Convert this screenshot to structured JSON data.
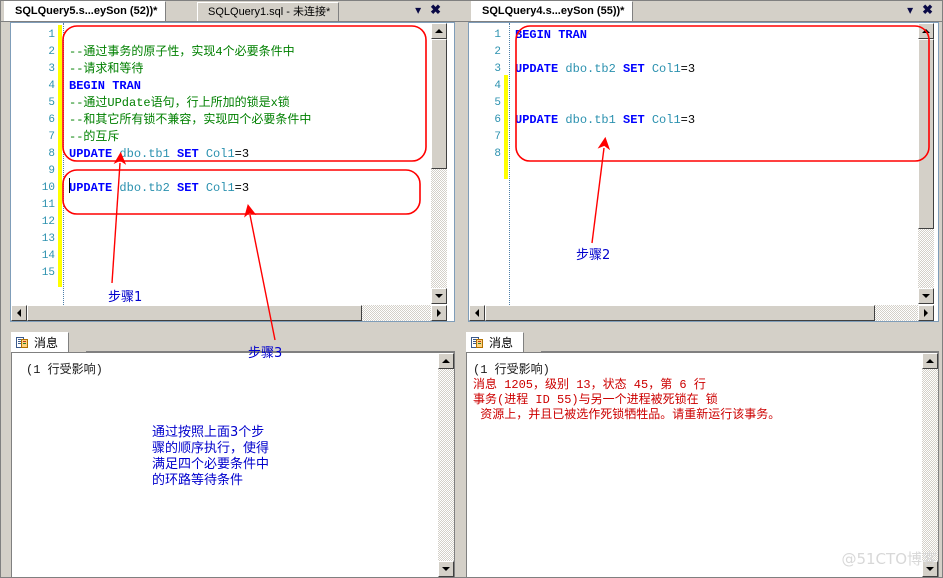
{
  "watermark": "@51CTO博客",
  "left_pane": {
    "tabs": [
      {
        "label": "SQLQuery5.s...eySon  (52))*",
        "active": true
      },
      {
        "label": "SQLQuery1.sql - 未连接*",
        "active": false
      }
    ],
    "window_buttons": {
      "dropdown": "▾",
      "close": "✖"
    },
    "editor": {
      "line_numbers": [
        "1",
        "2",
        "3",
        "4",
        "5",
        "6",
        "7",
        "8",
        "9",
        "10",
        "11",
        "12",
        "13",
        "14",
        "15"
      ],
      "lines": [
        {
          "n": 1,
          "segments": []
        },
        {
          "n": 2,
          "segments": [
            {
              "t": "--通过事务的原子性，实现4个必要条件中",
              "c": "cmt"
            }
          ]
        },
        {
          "n": 3,
          "segments": [
            {
              "t": "--请求和等待",
              "c": "cmt"
            }
          ]
        },
        {
          "n": 4,
          "segments": [
            {
              "t": "BEGIN TRAN",
              "c": "kw"
            }
          ]
        },
        {
          "n": 5,
          "segments": [
            {
              "t": "--通过UPdate语句，行上所加的锁是x锁",
              "c": "cmt"
            }
          ]
        },
        {
          "n": 6,
          "segments": [
            {
              "t": "--和其它所有锁不兼容，实现四个必要条件中",
              "c": "cmt"
            }
          ]
        },
        {
          "n": 7,
          "segments": [
            {
              "t": "--的互斥",
              "c": "cmt"
            }
          ]
        },
        {
          "n": 8,
          "segments": [
            {
              "t": "UPDATE",
              "c": "kw"
            },
            {
              "t": " ",
              "c": "num"
            },
            {
              "t": "dbo.tb1",
              "c": "ident"
            },
            {
              "t": " ",
              "c": "num"
            },
            {
              "t": "SET",
              "c": "kw"
            },
            {
              "t": " ",
              "c": "num"
            },
            {
              "t": "Col1",
              "c": "ident"
            },
            {
              "t": "=3",
              "c": "num"
            }
          ]
        },
        {
          "n": 9,
          "segments": []
        },
        {
          "n": 10,
          "segments": [
            {
              "t": "UPDATE",
              "c": "kw"
            },
            {
              "t": " ",
              "c": "num"
            },
            {
              "t": "dbo.tb2",
              "c": "ident"
            },
            {
              "t": " ",
              "c": "num"
            },
            {
              "t": "SET",
              "c": "kw"
            },
            {
              "t": " ",
              "c": "num"
            },
            {
              "t": "Col1",
              "c": "ident"
            },
            {
              "t": "=3",
              "c": "num"
            }
          ]
        },
        {
          "n": 11,
          "segments": []
        },
        {
          "n": 12,
          "segments": []
        },
        {
          "n": 13,
          "segments": []
        },
        {
          "n": 14,
          "segments": []
        },
        {
          "n": 15,
          "segments": []
        }
      ]
    },
    "messages": {
      "tab_label": "消息",
      "lines": [
        {
          "t": "(1 行受影响)",
          "c": "msg-normal"
        }
      ]
    }
  },
  "right_pane": {
    "tabs": [
      {
        "label": "SQLQuery4.s...eySon  (55))*",
        "active": true
      }
    ],
    "window_buttons": {
      "dropdown": "▾",
      "close": "✖"
    },
    "editor": {
      "line_numbers": [
        "1",
        "2",
        "3",
        "4",
        "5",
        "6",
        "7",
        "8"
      ],
      "lines": [
        {
          "n": 1,
          "segments": [
            {
              "t": "BEGIN TRAN",
              "c": "kw"
            }
          ]
        },
        {
          "n": 2,
          "segments": []
        },
        {
          "n": 3,
          "segments": [
            {
              "t": "UPDATE",
              "c": "kw"
            },
            {
              "t": " ",
              "c": "num"
            },
            {
              "t": "dbo.tb2",
              "c": "ident"
            },
            {
              "t": " ",
              "c": "num"
            },
            {
              "t": "SET",
              "c": "kw"
            },
            {
              "t": " ",
              "c": "num"
            },
            {
              "t": "Col1",
              "c": "ident"
            },
            {
              "t": "=3",
              "c": "num"
            }
          ]
        },
        {
          "n": 4,
          "segments": []
        },
        {
          "n": 5,
          "segments": []
        },
        {
          "n": 6,
          "segments": [
            {
              "t": "UPDATE",
              "c": "kw"
            },
            {
              "t": " ",
              "c": "num"
            },
            {
              "t": "dbo.tb1",
              "c": "ident"
            },
            {
              "t": " ",
              "c": "num"
            },
            {
              "t": "SET",
              "c": "kw"
            },
            {
              "t": " ",
              "c": "num"
            },
            {
              "t": "Col1",
              "c": "ident"
            },
            {
              "t": "=3",
              "c": "num"
            }
          ]
        },
        {
          "n": 7,
          "segments": []
        },
        {
          "n": 8,
          "segments": []
        }
      ]
    },
    "messages": {
      "tab_label": "消息",
      "lines": [
        {
          "t": "(1 行受影响)",
          "c": "msg-normal"
        },
        {
          "t": "消息 1205，级别 13，状态 45，第 6 行",
          "c": "msg-error"
        },
        {
          "t": "事务(进程 ID 55)与另一个进程被死锁在 锁",
          "c": "msg-error"
        },
        {
          "t": " 资源上，并且已被选作死锁牺牲品。请重新运行该事务。",
          "c": "msg-error"
        }
      ]
    }
  },
  "annotations": {
    "accent_color": "#ff0000",
    "label_color": "#0000cc",
    "step1": "步骤1",
    "step2": "步骤2",
    "step3": "步骤3",
    "summary": "通过按照上面3个步\n骤的顺序执行，使得\n满足四个必要条件中\n的环路等待条件"
  }
}
